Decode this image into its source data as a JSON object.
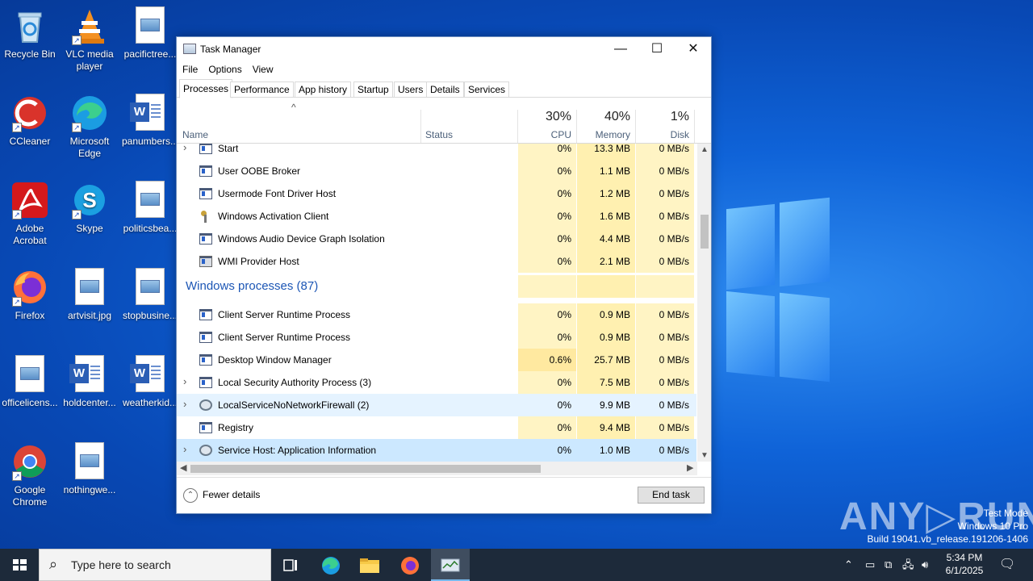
{
  "desktop": {
    "icons": [
      {
        "label": "Recycle Bin"
      },
      {
        "label": "VLC media player"
      },
      {
        "label": "pacifictree..."
      },
      {
        "label": "CCleaner"
      },
      {
        "label": "Microsoft Edge"
      },
      {
        "label": "panumbers..."
      },
      {
        "label": "Adobe Acrobat"
      },
      {
        "label": "Skype"
      },
      {
        "label": "politicsbea..."
      },
      {
        "label": "Firefox"
      },
      {
        "label": "artvisit.jpg"
      },
      {
        "label": "stopbusine..."
      },
      {
        "label": "officelicens..."
      },
      {
        "label": "holdcenter..."
      },
      {
        "label": "weatherkid..."
      },
      {
        "label": "Google Chrome"
      },
      {
        "label": "nothingwe..."
      }
    ]
  },
  "window": {
    "title": "Task Manager",
    "controls": {
      "minimize": "—",
      "maximize": "☐",
      "close": "✕"
    },
    "menu": [
      "File",
      "Options",
      "View"
    ],
    "tabs": [
      "Processes",
      "Performance",
      "App history",
      "Startup",
      "Users",
      "Details",
      "Services"
    ],
    "active_tab": "Processes"
  },
  "columns": {
    "sort_arrow": "^",
    "name": "Name",
    "status": "Status",
    "cpu": {
      "percent": "30%",
      "label": "CPU"
    },
    "memory": {
      "percent": "40%",
      "label": "Memory"
    },
    "disk": {
      "percent": "1%",
      "label": "Disk"
    }
  },
  "processes": [
    {
      "name": "Start",
      "cpu": "0%",
      "memory": "13.3 MB",
      "disk": "0 MB/s",
      "expandable": true,
      "icon": "app-window-icon"
    },
    {
      "name": "User OOBE Broker",
      "cpu": "0%",
      "memory": "1.1 MB",
      "disk": "0 MB/s",
      "expandable": false,
      "icon": "app-window-icon"
    },
    {
      "name": "Usermode Font Driver Host",
      "cpu": "0%",
      "memory": "1.2 MB",
      "disk": "0 MB/s",
      "expandable": false,
      "icon": "app-window-icon"
    },
    {
      "name": "Windows Activation Client",
      "cpu": "0%",
      "memory": "1.6 MB",
      "disk": "0 MB/s",
      "expandable": false,
      "icon": "key-icon"
    },
    {
      "name": "Windows Audio Device Graph Isolation",
      "cpu": "0%",
      "memory": "4.4 MB",
      "disk": "0 MB/s",
      "expandable": false,
      "icon": "app-window-icon"
    },
    {
      "name": "WMI Provider Host",
      "cpu": "0%",
      "memory": "2.1 MB",
      "disk": "0 MB/s",
      "expandable": false,
      "icon": "wmi-icon"
    }
  ],
  "section": {
    "title": "Windows processes (87)"
  },
  "windows_processes": [
    {
      "name": "Client Server Runtime Process",
      "cpu": "0%",
      "memory": "0.9 MB",
      "disk": "0 MB/s",
      "expandable": false,
      "icon": "app-window-icon"
    },
    {
      "name": "Client Server Runtime Process",
      "cpu": "0%",
      "memory": "0.9 MB",
      "disk": "0 MB/s",
      "expandable": false,
      "icon": "app-window-icon"
    },
    {
      "name": "Desktop Window Manager",
      "cpu": "0.6%",
      "memory": "25.7 MB",
      "disk": "0 MB/s",
      "expandable": false,
      "icon": "app-window-icon"
    },
    {
      "name": "Local Security Authority Process (3)",
      "cpu": "0%",
      "memory": "7.5 MB",
      "disk": "0 MB/s",
      "expandable": true,
      "icon": "app-window-icon"
    },
    {
      "name": "LocalServiceNoNetworkFirewall (2)",
      "cpu": "0%",
      "memory": "9.9 MB",
      "disk": "0 MB/s",
      "expandable": true,
      "icon": "gear-icon"
    },
    {
      "name": "Registry",
      "cpu": "0%",
      "memory": "9.4 MB",
      "disk": "0 MB/s",
      "expandable": false,
      "icon": "app-window-icon"
    },
    {
      "name": "Service Host: Application Information",
      "cpu": "0%",
      "memory": "1.0 MB",
      "disk": "0 MB/s",
      "expandable": true,
      "icon": "gear-icon"
    }
  ],
  "footer": {
    "fewer_details": "Fewer details",
    "end_task": "End task"
  },
  "watermark": {
    "brand": "ANY RUN",
    "line1": "Test Mode",
    "line2": "Windows 10 Pro",
    "line3": "Build 19041.vb_release.191206-1406"
  },
  "taskbar": {
    "search_placeholder": "Type here to search",
    "time": "5:34 PM",
    "date": "6/1/2025"
  }
}
